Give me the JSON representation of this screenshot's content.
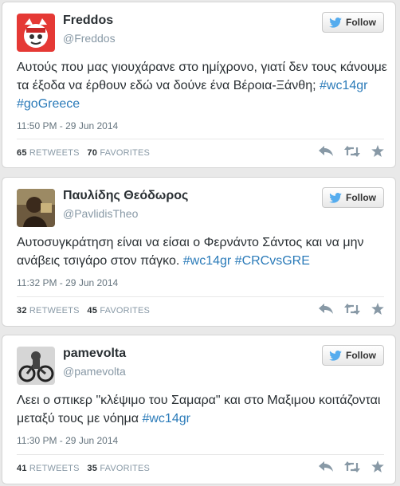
{
  "follow_label": "Follow",
  "tweets": [
    {
      "name": "Freddos",
      "handle": "@Freddos",
      "text_plain": "Αυτούς που μας γιουχάρανε στο ημίχρονο, γιατί δεν τους κάνουμε τα έξοδα να έρθουν εδώ να δούνε ένα Βέροια-Ξάνθη; ",
      "hashtags": [
        "#wc14gr",
        "#goGreece"
      ],
      "time": "11:50 PM - 29 Jun 2014",
      "retweets": "65",
      "retweets_label": "RETWEETS",
      "favorites": "70",
      "favorites_label": "FAVORITES"
    },
    {
      "name": "Παυλίδης Θεόδωρος",
      "handle": "@PavlidisTheo",
      "text_plain": "Αυτοσυγκράτηση είναι να είσαι ο Φερνάντο Σάντος και να μην ανάβεις τσιγάρο στον πάγκο. ",
      "hashtags": [
        "#wc14gr",
        "#CRCvsGRE"
      ],
      "time": "11:32 PM - 29 Jun 2014",
      "retweets": "32",
      "retweets_label": "RETWEETS",
      "favorites": "45",
      "favorites_label": "FAVORITES"
    },
    {
      "name": "pamevolta",
      "handle": "@pamevolta",
      "text_plain": "Λεει ο σπικερ \"κλέψιμο του Σαμαρα\" και στο Μαξιμου κοιτάζονται μεταξύ τους με νόημα ",
      "hashtags": [
        "#wc14gr"
      ],
      "time": "11:30 PM - 29 Jun 2014",
      "retweets": "41",
      "retweets_label": "RETWEETS",
      "favorites": "35",
      "favorites_label": "FAVORITES"
    }
  ],
  "icons": {
    "bird": "twitter-bird-icon",
    "reply": "reply-icon",
    "retweet": "retweet-icon",
    "favorite": "star-icon"
  },
  "colors": {
    "hashtag": "#2b7bb9",
    "bird": "#55acee",
    "action_icon": "#8899a6"
  }
}
